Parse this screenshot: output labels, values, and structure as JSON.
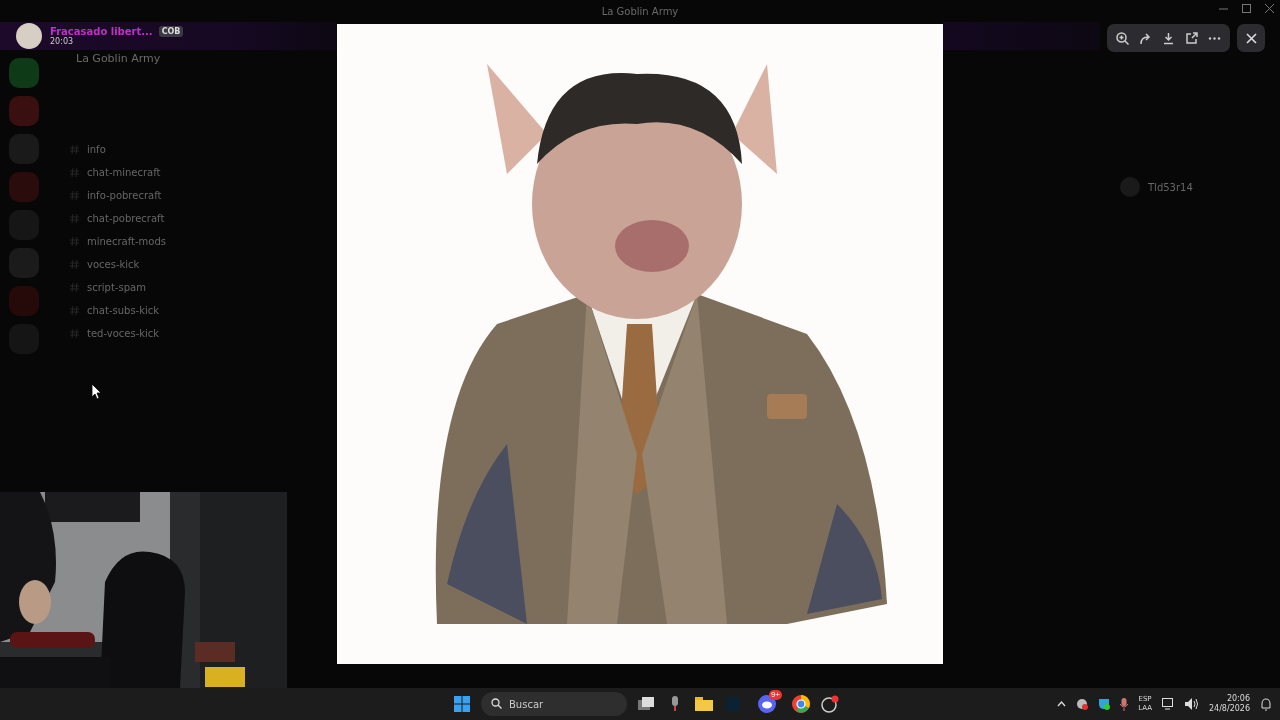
{
  "window": {
    "title": "La Goblin Army"
  },
  "notification": {
    "author": "Fracasado libert...",
    "badge": "COB",
    "time": "20:03"
  },
  "server": {
    "name": "La Goblin Army"
  },
  "channels": [
    {
      "name": "info"
    },
    {
      "name": "chat-minecraft"
    },
    {
      "name": "info-pobrecraft"
    },
    {
      "name": "chat-pobrecraft"
    },
    {
      "name": "minecraft-mods"
    },
    {
      "name": "voces-kick"
    },
    {
      "name": "script-spam"
    },
    {
      "name": "chat-subs-kick"
    },
    {
      "name": "ted-voces-kick"
    }
  ],
  "members": [
    {
      "name": "Tld53r14"
    }
  ],
  "taskbar": {
    "search": {
      "placeholder": "Buscar"
    },
    "chat_badge": "9+",
    "language": [
      "ESP",
      "LAA"
    ],
    "time": "20:06",
    "date": "24/8/2026"
  }
}
